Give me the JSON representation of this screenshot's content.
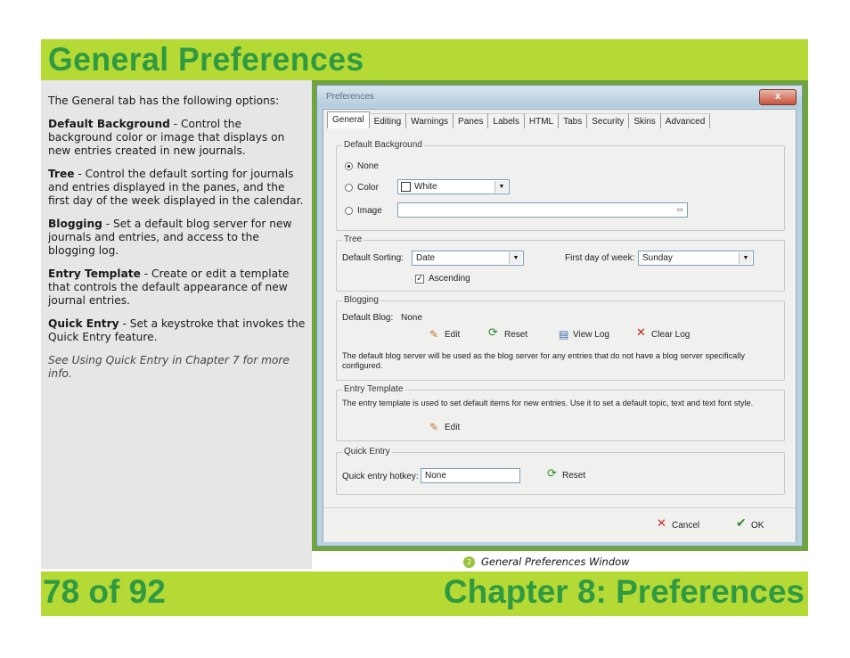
{
  "header": {
    "title": "General Preferences"
  },
  "left_panel": {
    "intro": "The General tab has the following options:",
    "items": [
      {
        "term": "Default Background",
        "desc": " - Control the background color or image that displays on new entries created in new journals."
      },
      {
        "term": "Tree",
        "desc": " - Control the default sorting for journals and entries displayed in the panes, and the first day of the week displayed in the calendar."
      },
      {
        "term": "Blogging",
        "desc": " - Set a default blog server for new journals and entries, and access to the blogging  log."
      },
      {
        "term": "Entry Template",
        "desc": " - Create or edit a template that controls the default appearance of new journal entries."
      },
      {
        "term": "Quick Entry",
        "desc": " - Set a keystroke that invokes the Quick Entry feature."
      }
    ],
    "note": "See Using Quick Entry in Chapter 7 for more info."
  },
  "dialog": {
    "title": "Preferences",
    "close_label": "x",
    "tabs": [
      "General",
      "Editing",
      "Warnings",
      "Panes",
      "Labels",
      "HTML",
      "Tabs",
      "Security",
      "Skins",
      "Advanced"
    ],
    "active_tab": "General",
    "default_background": {
      "group_label": "Default Background",
      "option_none": "None",
      "option_color": "Color",
      "option_image": "Image",
      "selected": "None",
      "color_value": "White",
      "image_value": ""
    },
    "tree": {
      "group_label": "Tree",
      "sorting_label": "Default Sorting:",
      "sorting_value": "Date",
      "first_day_label": "First day of week:",
      "first_day_value": "Sunday",
      "ascending_label": "Ascending",
      "ascending_checked": true
    },
    "blogging": {
      "group_label": "Blogging",
      "default_blog_label": "Default Blog:",
      "default_blog_value": "None",
      "edit_label": "Edit",
      "reset_label": "Reset",
      "view_log_label": "View Log",
      "clear_log_label": "Clear Log",
      "description": "The default blog server will be used as the blog server for any entries that do not have a blog server specifically configured."
    },
    "entry_template": {
      "group_label": "Entry Template",
      "description": "The entry template is used to set default items for new entries.  Use it to set a default topic, text and text font style.",
      "edit_label": "Edit"
    },
    "quick_entry": {
      "group_label": "Quick Entry",
      "hotkey_label": "Quick entry hotkey:",
      "hotkey_value": "None",
      "reset_label": "Reset"
    },
    "cancel_label": "Cancel",
    "ok_label": "OK"
  },
  "caption": {
    "number": "2",
    "text": "General Preferences Window"
  },
  "footer": {
    "page": "78 of 92",
    "chapter": "Chapter 8: Preferences"
  },
  "colors": {
    "accent_green": "#b5d935",
    "title_green": "#2f9a41",
    "panel_gray": "#e6e6e6"
  }
}
